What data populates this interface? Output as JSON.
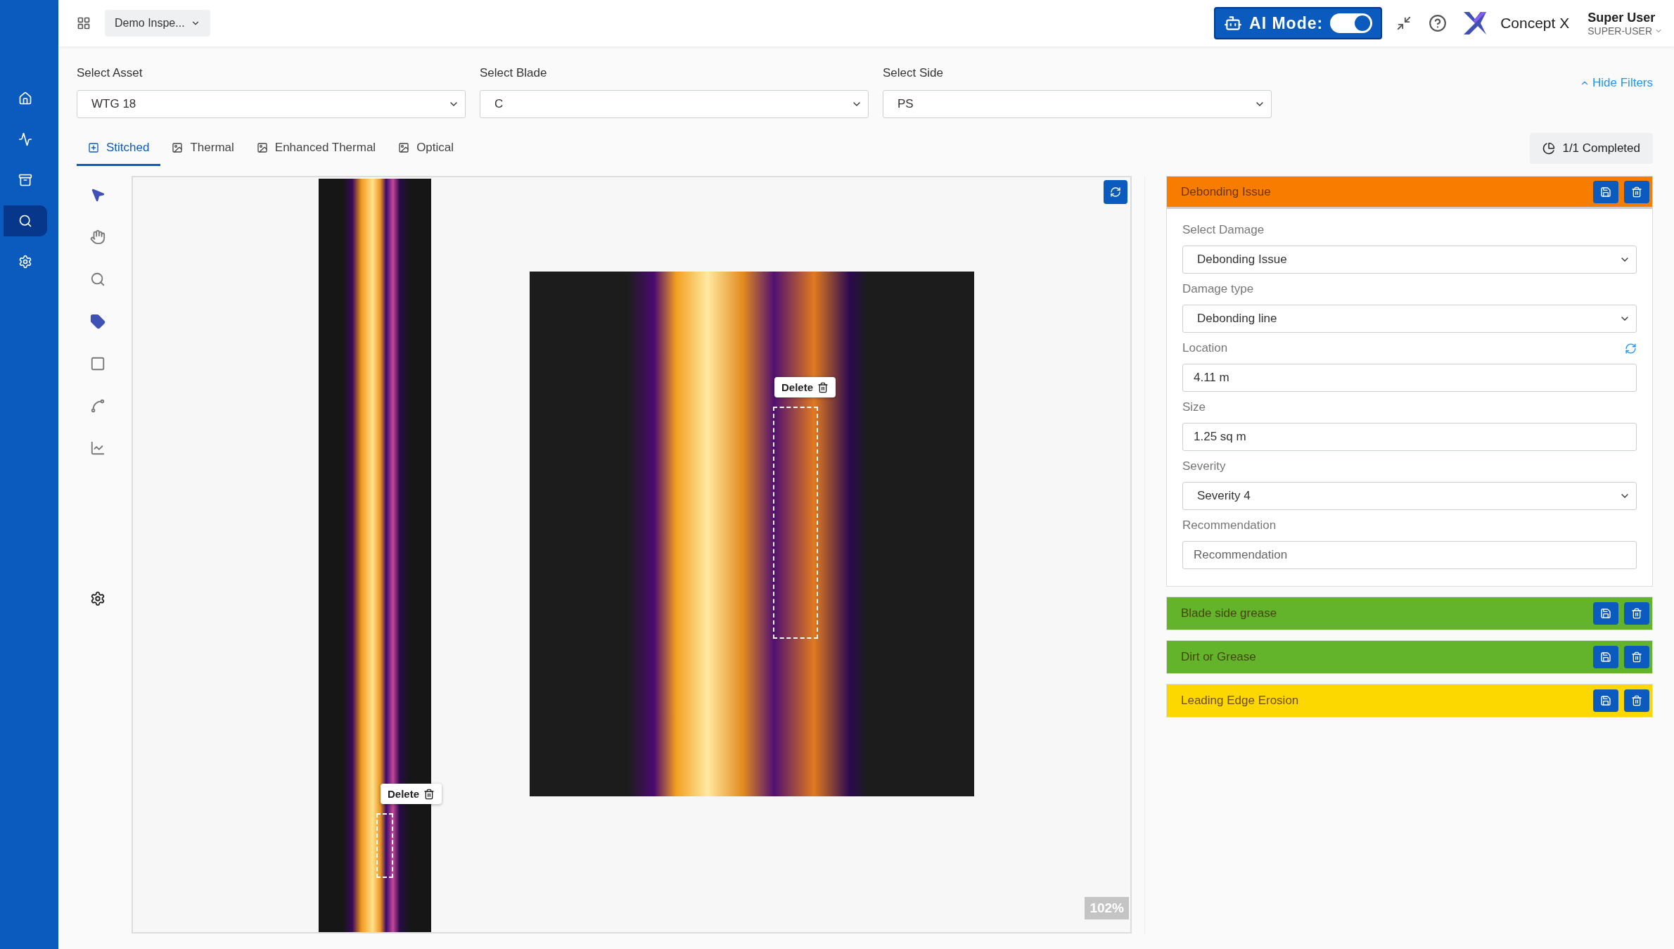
{
  "header": {
    "project": "Demo Inspe...",
    "ai_mode": {
      "label": "AI Mode:",
      "on": true
    },
    "brand": "Concept X",
    "user": {
      "name": "Super User",
      "role": "SUPER-USER"
    }
  },
  "nav": [
    {
      "selected": false
    },
    {
      "selected": false
    },
    {
      "selected": false
    },
    {
      "selected": true
    },
    {
      "selected": false
    }
  ],
  "filters": [
    {
      "label": "Select Asset",
      "value": "WTG 18"
    },
    {
      "label": "Select Blade",
      "value": "C"
    },
    {
      "label": "Select Side",
      "value": "PS"
    }
  ],
  "hide_filters": "Hide Filters",
  "tabs": [
    {
      "label": "Stitched",
      "selected": true
    },
    {
      "label": "Thermal",
      "selected": false
    },
    {
      "label": "Enhanced Thermal",
      "selected": false
    },
    {
      "label": "Optical",
      "selected": false
    }
  ],
  "completed": "1/1 Completed",
  "tools": [
    {
      "kind": "pointer",
      "selected": true
    },
    {
      "kind": "hand",
      "selected": false
    },
    {
      "kind": "zoom",
      "selected": false
    },
    {
      "kind": "tag",
      "selected": true
    },
    {
      "kind": "rectangle",
      "selected": false
    },
    {
      "kind": "polygon",
      "selected": false
    },
    {
      "kind": "chart",
      "selected": false
    }
  ],
  "canvas": {
    "overview_delete": "Delete",
    "detail_delete": "Delete",
    "zoom": "102%"
  },
  "damages": [
    {
      "title": "Debonding Issue",
      "color": "#f77c00",
      "expanded": true,
      "fields": [
        {
          "kind": "select",
          "label": "Select Damage",
          "value": "Debonding Issue"
        },
        {
          "kind": "select",
          "label": "Damage type",
          "value": "Debonding line"
        },
        {
          "kind": "refresh_input",
          "label": "Location",
          "value": "4.11 m"
        },
        {
          "kind": "input",
          "label": "Size",
          "value": "1.25 sq m"
        },
        {
          "kind": "select",
          "label": "Severity",
          "value": "Severity 4"
        },
        {
          "kind": "input",
          "label": "Recommendation",
          "placeholder": "Recommendation"
        }
      ]
    },
    {
      "title": "Blade side grease",
      "color": "#63b42a"
    },
    {
      "title": "Dirt or Grease",
      "color": "#63b42a"
    },
    {
      "title": "Leading Edge Erosion",
      "color": "#fcd800"
    }
  ]
}
